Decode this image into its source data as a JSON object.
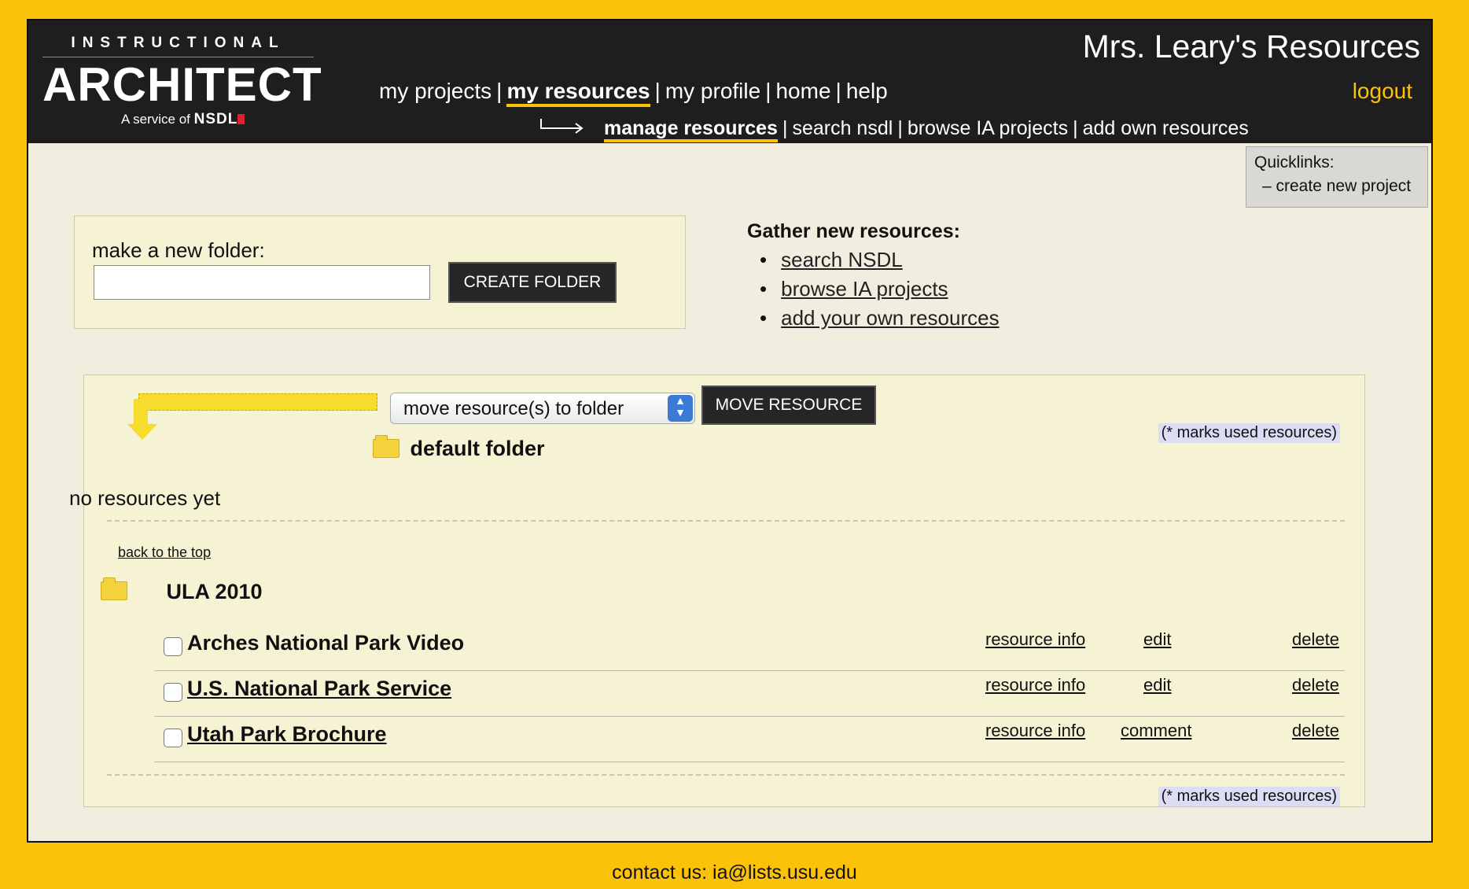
{
  "header": {
    "logo_top": "INSTRUCTIONAL",
    "logo_main": "ARCHITECT",
    "logo_sub": "A service of",
    "logo_brand": "NSDL",
    "site_title": "Mrs. Leary's Resources",
    "logout": "logout"
  },
  "mainnav": {
    "items": [
      "my projects",
      "my resources",
      "my profile",
      "home",
      "help"
    ],
    "active": "my resources"
  },
  "subnav": {
    "items": [
      "manage resources",
      "search nsdl",
      "browse IA projects",
      "add own resources"
    ],
    "active": "manage resources"
  },
  "quicklinks": {
    "title": "Quicklinks:",
    "item": "– create new project"
  },
  "newfolder": {
    "label": "make a new folder:",
    "value": "",
    "button": "CREATE FOLDER"
  },
  "gather": {
    "title": "Gather new resources:",
    "links": [
      "search NSDL",
      "browse IA projects",
      "add your own resources"
    ]
  },
  "move": {
    "select_value": "move resource(s) to folder",
    "button": "MOVE RESOURCE"
  },
  "marks_note": "(* marks used resources)",
  "folders": [
    {
      "name": "default folder",
      "empty_text": "no resources yet"
    },
    {
      "name": "ULA 2010"
    }
  ],
  "back_to_top": "back to the top",
  "resources": [
    {
      "title": "Arches National Park Video",
      "linked": false,
      "actions": [
        "resource info",
        "edit",
        "delete"
      ]
    },
    {
      "title": "U.S. National Park Service",
      "linked": true,
      "actions": [
        "resource info",
        "edit",
        "delete"
      ]
    },
    {
      "title": "Utah Park Brochure",
      "linked": true,
      "actions": [
        "resource info",
        "comment",
        "delete"
      ]
    }
  ],
  "footer": "contact us: ia@lists.usu.edu"
}
